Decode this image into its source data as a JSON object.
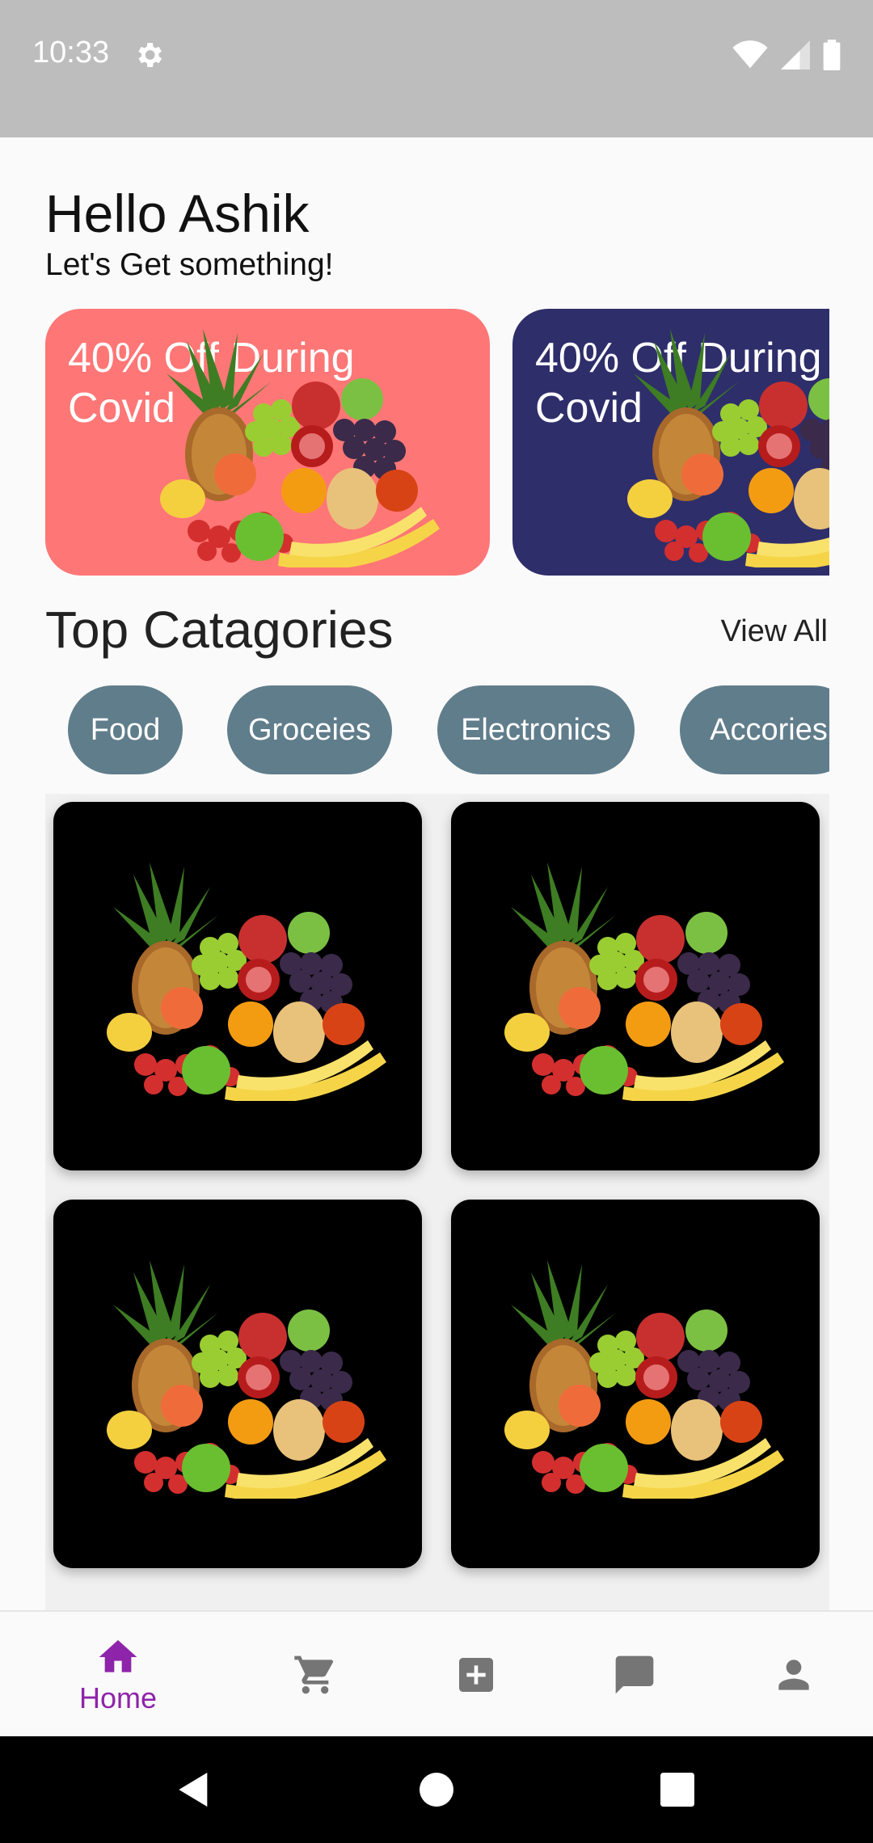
{
  "status_bar": {
    "time": "10:33"
  },
  "header": {
    "greeting": "Hello Ashik",
    "subtitle": "Let's Get something!"
  },
  "banners": [
    {
      "text": "40% Off During Covid",
      "color": "#ff7676"
    },
    {
      "text": "40% Off During Covid",
      "color": "#2e2e6b"
    }
  ],
  "categories_section": {
    "title": "Top Catagories",
    "view_all": "View All",
    "chips": [
      "Food",
      "Groceies",
      "Electronics",
      "Accories"
    ]
  },
  "products": [
    {
      "image": "fruit-basket"
    },
    {
      "image": "fruit-basket"
    },
    {
      "image": "fruit-basket"
    },
    {
      "image": "fruit-basket"
    }
  ],
  "bottom_nav": {
    "items": [
      {
        "icon": "home-icon",
        "label": "Home",
        "active": true
      },
      {
        "icon": "cart-icon"
      },
      {
        "icon": "add-box-icon"
      },
      {
        "icon": "chat-icon"
      },
      {
        "icon": "person-icon"
      }
    ],
    "active_color": "#8e24aa",
    "inactive_color": "#757575"
  },
  "colors": {
    "chip": "#607d8b",
    "status_bar": "#bdbdbd"
  }
}
